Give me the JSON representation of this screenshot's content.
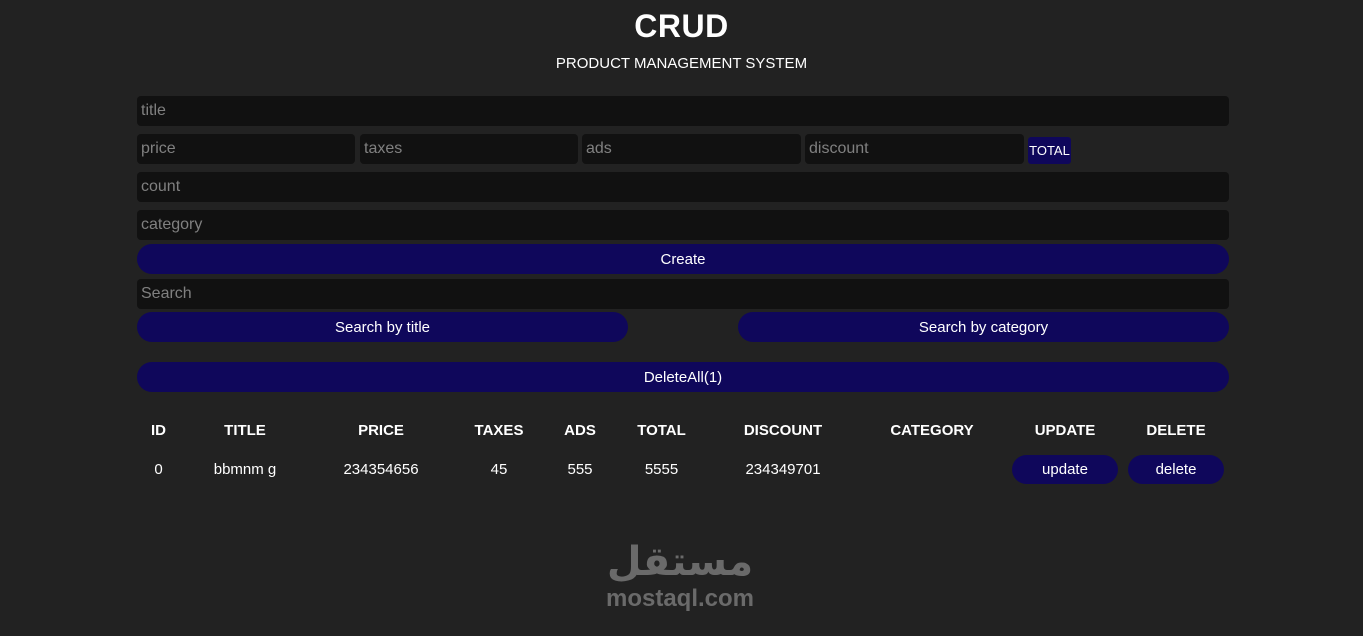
{
  "header": {
    "title": "CRUD",
    "subtitle": "PRODUCT MANAGEMENT SYSTEM"
  },
  "form": {
    "title_placeholder": "title",
    "price_placeholder": "price",
    "taxes_placeholder": "taxes",
    "ads_placeholder": "ads",
    "discount_placeholder": "discount",
    "total_label": "TOTAL",
    "count_placeholder": "count",
    "category_placeholder": "category",
    "create_label": "Create"
  },
  "search": {
    "placeholder": "Search",
    "by_title_label": "Search by title",
    "by_category_label": "Search by category",
    "delete_all_label": "DeleteAll(1)"
  },
  "table": {
    "headers": {
      "id": "ID",
      "title": "TITLE",
      "price": "PRICE",
      "taxes": "TAXES",
      "ads": "ADS",
      "total": "TOTAL",
      "discount": "DISCOUNT",
      "category": "CATEGORY",
      "update": "UPDATE",
      "delete": "DELETE"
    },
    "rows": [
      {
        "id": "0",
        "title": "bbmnm g",
        "price": "234354656",
        "taxes": "45",
        "ads": "555",
        "total": "5555",
        "discount": "234349701",
        "category": "",
        "update_label": "update",
        "delete_label": "delete"
      }
    ]
  },
  "watermark": {
    "arabic": "مستقل",
    "latin": "mostaql.com"
  },
  "colors": {
    "background": "#222222",
    "input": "#111111",
    "button": "#0f075b",
    "placeholder": "#808080"
  }
}
